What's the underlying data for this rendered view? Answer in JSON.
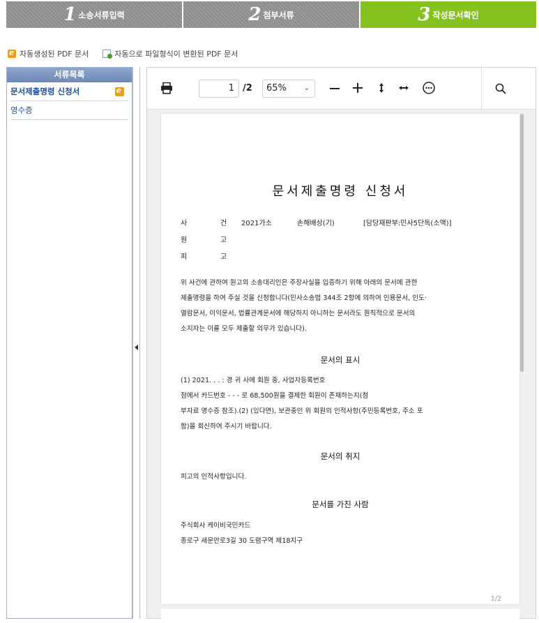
{
  "steps": [
    {
      "num": "1",
      "label": "소송서류입력"
    },
    {
      "num": "2",
      "label": "첨부서류"
    },
    {
      "num": "3",
      "label": "작성문서확인"
    }
  ],
  "legend": {
    "auto_pdf": "자동생성된 PDF 문서",
    "converted_pdf": "자동으로 파일형식이 변환된 PDF 문서"
  },
  "sidebar": {
    "title": "서류목록",
    "items": [
      {
        "label": "문서제출명령 신청서",
        "selected": true
      },
      {
        "label": "영수증",
        "selected": false
      }
    ]
  },
  "toolbar": {
    "current_page": "1",
    "total_pages": "/2",
    "zoom": "65%"
  },
  "document": {
    "title": "문서제출명령 신청서",
    "case_label_1": "사",
    "case_label_2": "건",
    "case_no": "2021가소",
    "case_name": "손해배상(기)",
    "dept": "[담당재판부:민사5단독(소액)]",
    "plaintiff_1": "원",
    "plaintiff_2": "고",
    "defendant_1": "피",
    "defendant_2": "고",
    "intro_lines": [
      "위 사건에 관하여 원고의 소송대리인은 주장사실을 입증하기 위해 아래의 문서에 관한",
      "제출명령을 하여 주실 것을 신청합니다(민사소송법 344조 2항에 의하여 인용문서, 인도·",
      "열람문서, 이익문서, 법률관계문서에 해당하지 아니하는 문서라도 원칙적으로 문서의",
      "소지자는 이를 모두 제출할 의무가 있습니다)."
    ],
    "sec1": "문서의 표시",
    "sec1_lines": [
      "(1) 2021.   .    .    :  경 귀 사에 회원 중, 사업자등록번호",
      "      점에서 카드번호         -      -      -      로 68,500원을 결제한 회원이 존재하는지(첨",
      "부자료 영수증 참조).(2) (있다면), 보관중인 위 회원의 인적사항(주민등록번호, 주소 포",
      "함)을 회신하여 주시기 바랍니다."
    ],
    "sec2": "문서의 취지",
    "sec2_line": "피고의 인적사항입니다.",
    "sec3": "문서를 가진 사람",
    "holder_name": "주식회사 케이비국민카드",
    "holder_addr": "종로구 새문안로3길 30 도렴구역 제18지구",
    "page_num": "1/2"
  }
}
